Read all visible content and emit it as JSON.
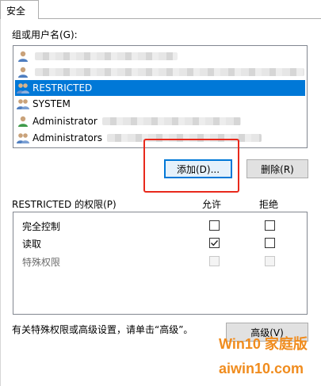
{
  "tab": {
    "label": "安全"
  },
  "groups": {
    "label": "组或用户名(G):",
    "items": [
      {
        "name": "",
        "icon": "user-icon",
        "selected": false,
        "blurred": true
      },
      {
        "name": "",
        "icon": "user-icon",
        "selected": false,
        "blurred": true
      },
      {
        "name": "RESTRICTED",
        "icon": "users-group-icon",
        "selected": true,
        "blurred": false
      },
      {
        "name": "SYSTEM",
        "icon": "users-group-icon",
        "selected": false,
        "blurred": false
      },
      {
        "name": "Administrator",
        "icon": "user-icon",
        "selected": false,
        "blurred": true
      },
      {
        "name": "Administrators",
        "icon": "users-group-icon",
        "selected": false,
        "blurred": true
      }
    ]
  },
  "buttons": {
    "add": "添加(D)...",
    "remove": "删除(R)",
    "advanced": "高级(V)"
  },
  "permissions": {
    "label": "RESTRICTED 的权限(P)",
    "allow_header": "允许",
    "deny_header": "拒绝",
    "rows": [
      {
        "name": "完全控制",
        "allow": false,
        "deny": false,
        "enabled": true
      },
      {
        "name": "读取",
        "allow": true,
        "deny": false,
        "enabled": true
      },
      {
        "name": "特殊权限",
        "allow": false,
        "deny": false,
        "enabled": false
      }
    ]
  },
  "footer": {
    "note": "有关特殊权限或高级设置，请单击“高级”。"
  },
  "watermark": {
    "line1": "Win10 家庭版",
    "line2": "aiwin10.com"
  },
  "colors": {
    "selection": "#0078d7",
    "highlight_box": "#e8291c",
    "watermark": "#f08c1e"
  }
}
